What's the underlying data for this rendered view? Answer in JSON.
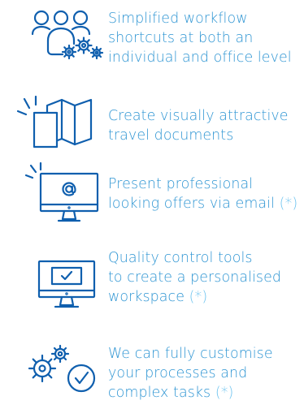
{
  "features": [
    {
      "icon": "users-settings-icon",
      "lines": [
        "Simplified workflow",
        "shortcuts at both an",
        "individual and office level"
      ],
      "note": ""
    },
    {
      "icon": "travel-documents-icon",
      "lines": [
        "Create visually attractive",
        "travel documents"
      ],
      "note": ""
    },
    {
      "icon": "email-monitor-icon",
      "lines": [
        "Present professional",
        "looking offers via email"
      ],
      "note": "(*)"
    },
    {
      "icon": "checkbox-monitor-icon",
      "lines": [
        "Quality control tools",
        "to create a personalised",
        "workspace"
      ],
      "note": "(*)"
    },
    {
      "icon": "gears-check-icon",
      "lines": [
        "We can fully customise",
        "your processes and",
        "complex tasks"
      ],
      "note": "(*)"
    }
  ],
  "colors": {
    "icon": "#0f5fae",
    "text": "#2e95d3",
    "note": "#69c2ef"
  }
}
